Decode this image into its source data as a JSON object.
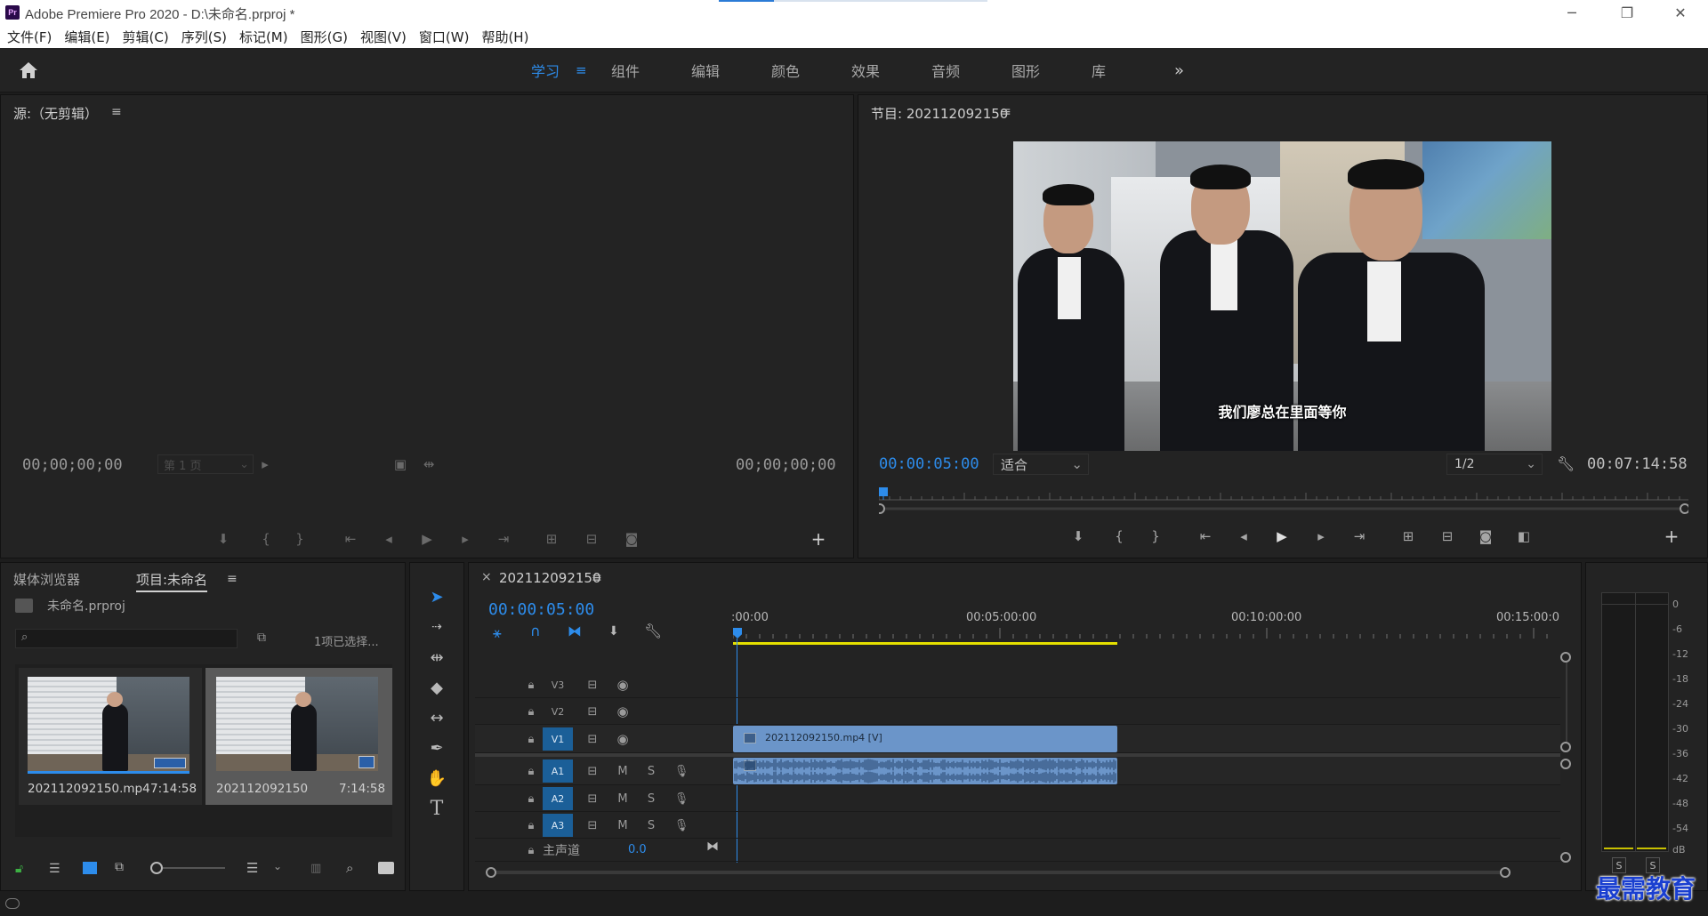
{
  "window": {
    "title": "Adobe Premiere Pro 2020 - D:\\未命名.prproj *",
    "logo": "Pr",
    "controls": [
      "minimize-icon",
      "restore-icon",
      "close-icon"
    ]
  },
  "menu": [
    "文件(F)",
    "编辑(E)",
    "剪辑(C)",
    "序列(S)",
    "标记(M)",
    "图形(G)",
    "视图(V)",
    "窗口(W)",
    "帮助(H)"
  ],
  "workspace": {
    "tabs": [
      "学习",
      "组件",
      "编辑",
      "颜色",
      "效果",
      "音频",
      "图形",
      "库"
    ],
    "active": "学习",
    "overflow": "»"
  },
  "source": {
    "title": "源:（无剪辑）",
    "tc_left": "00;00;00;00",
    "tc_right": "00;00;00;00",
    "page_select": "第 1 页"
  },
  "program": {
    "title": "节目: 202112092150",
    "tc_current": "00:00:05:00",
    "fit": "适合",
    "resolution": "1/2",
    "tc_duration": "00:07:14:58",
    "subtitle": "我们廖总在里面等你"
  },
  "project": {
    "tab_media": "媒体浏览器",
    "tab_project": "项目:未命名",
    "file": "未命名.prproj",
    "search_placeholder": "",
    "selection": "1项已选择...",
    "items": [
      {
        "name": "202112092150.mp4",
        "duration": "7:14:58",
        "selected": false
      },
      {
        "name": "202112092150",
        "duration": "7:14:58",
        "selected": true
      }
    ]
  },
  "timeline": {
    "seq_name": "202112092150",
    "tc": "00:00:05:00",
    "ruler": [
      ":00:00",
      "00:05:00:00",
      "00:10:00:00",
      "00:15:00:0"
    ],
    "tracks_video": [
      "V3",
      "V2",
      "V1"
    ],
    "tracks_audio": [
      "A1",
      "A2",
      "A3"
    ],
    "master_label": "主声道",
    "master_value": "0.0",
    "video_clip": "202112092150.mp4 [V]",
    "mute": "M",
    "solo": "S"
  },
  "meter": {
    "ticks": [
      "0",
      "-6",
      "-12",
      "-18",
      "-24",
      "-30",
      "-36",
      "-42",
      "-48",
      "-54",
      "dB"
    ],
    "solo_left": "S",
    "solo_right": "S"
  },
  "watermark": "最需教育",
  "colors": {
    "accent": "#2d8ceb",
    "clip": "#6b95c9",
    "workarea": "#e5e000"
  }
}
